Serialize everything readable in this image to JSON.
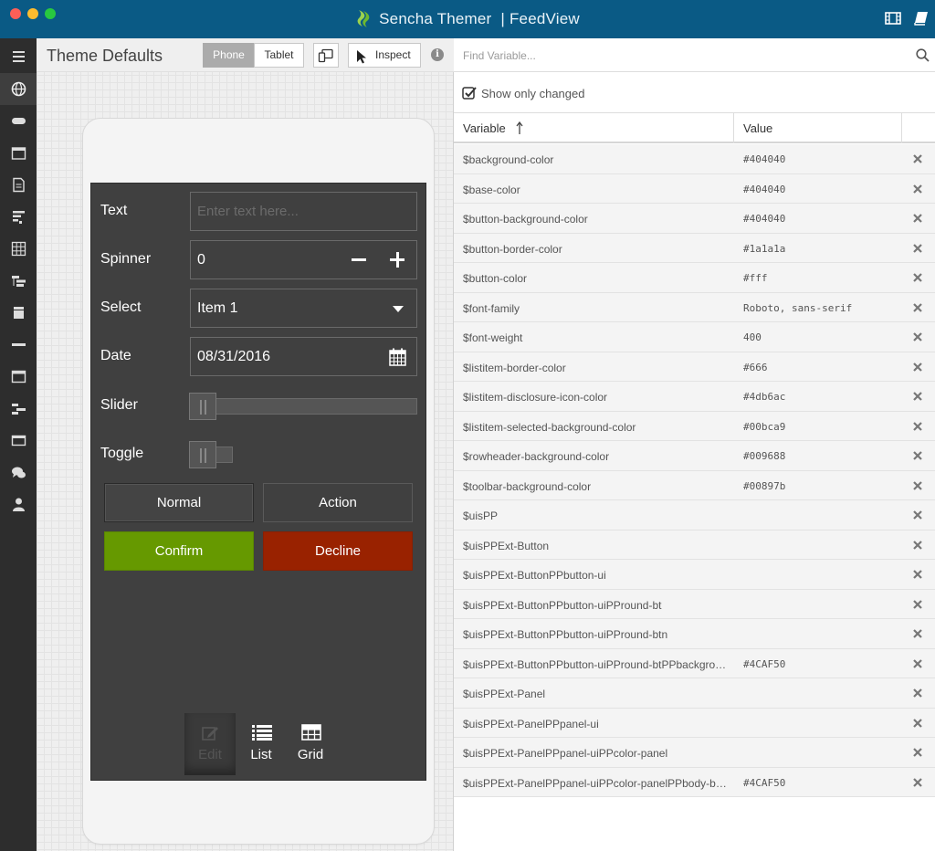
{
  "window": {
    "app_name": "Sencha Themer",
    "separator": "|",
    "project_name": "FeedView"
  },
  "preview": {
    "title": "Theme Defaults",
    "device_tabs": {
      "phone": "Phone",
      "tablet": "Tablet"
    },
    "selected_device": "Phone",
    "inspect_label": "Inspect",
    "info_glyph": "i"
  },
  "form": {
    "text": {
      "label": "Text",
      "placeholder": "Enter text here..."
    },
    "spinner": {
      "label": "Spinner",
      "value": "0"
    },
    "select": {
      "label": "Select",
      "value": "Item 1"
    },
    "date": {
      "label": "Date",
      "value": "08/31/2016"
    },
    "slider": {
      "label": "Slider",
      "value": 0
    },
    "toggle": {
      "label": "Toggle",
      "checked": false
    }
  },
  "buttons": {
    "normal": "Normal",
    "action": "Action",
    "confirm": "Confirm",
    "decline": "Decline"
  },
  "colors": {
    "confirm": "#669900",
    "decline": "#992200",
    "titlebar": "#0a5a85",
    "preview_background": "#404040"
  },
  "tabbar": {
    "items": [
      {
        "label": "Edit",
        "icon": "edit-icon",
        "active": true
      },
      {
        "label": "List",
        "icon": "list-icon",
        "active": false
      },
      {
        "label": "Grid",
        "icon": "grid-icon",
        "active": false
      }
    ]
  },
  "sidebar_icons": [
    "menu-icon",
    "globe-icon",
    "button-icon",
    "calendar-icon",
    "document-icon",
    "form-icon",
    "grid-icon",
    "tree-icon",
    "panel-icon",
    "divider-icon",
    "window-icon",
    "hierarchy-icon",
    "tab-icon",
    "chat-icon",
    "user-icon"
  ],
  "variables": {
    "search_placeholder": "Find Variable...",
    "show_only_changed_label": "Show only changed",
    "show_only_changed": true,
    "col_variable": "Variable",
    "col_value": "Value",
    "sort": "ascending",
    "rows": [
      {
        "name": "$background-color",
        "value": "#404040"
      },
      {
        "name": "$base-color",
        "value": "#404040"
      },
      {
        "name": "$button-background-color",
        "value": "#404040"
      },
      {
        "name": "$button-border-color",
        "value": "#1a1a1a"
      },
      {
        "name": "$button-color",
        "value": "#fff"
      },
      {
        "name": "$font-family",
        "value": "Roboto, sans-serif"
      },
      {
        "name": "$font-weight",
        "value": "400"
      },
      {
        "name": "$listitem-border-color",
        "value": "#666"
      },
      {
        "name": "$listitem-disclosure-icon-color",
        "value": "#4db6ac"
      },
      {
        "name": "$listitem-selected-background-color",
        "value": "#00bca9"
      },
      {
        "name": "$rowheader-background-color",
        "value": "#009688"
      },
      {
        "name": "$toolbar-background-color",
        "value": "#00897b"
      },
      {
        "name": "$uisPP",
        "value": ""
      },
      {
        "name": "$uisPPExt-Button",
        "value": ""
      },
      {
        "name": "$uisPPExt-ButtonPPbutton-ui",
        "value": ""
      },
      {
        "name": "$uisPPExt-ButtonPPbutton-uiPPround-bt",
        "value": ""
      },
      {
        "name": "$uisPPExt-ButtonPPbutton-uiPPround-btn",
        "value": ""
      },
      {
        "name": "$uisPPExt-ButtonPPbutton-uiPPround-btPPbackgrou...",
        "value": "#4CAF50"
      },
      {
        "name": "$uisPPExt-Panel",
        "value": ""
      },
      {
        "name": "$uisPPExt-PanelPPpanel-ui",
        "value": ""
      },
      {
        "name": "$uisPPExt-PanelPPpanel-uiPPcolor-panel",
        "value": ""
      },
      {
        "name": "$uisPPExt-PanelPPpanel-uiPPcolor-panelPPbody-bac...",
        "value": "#4CAF50"
      }
    ]
  }
}
